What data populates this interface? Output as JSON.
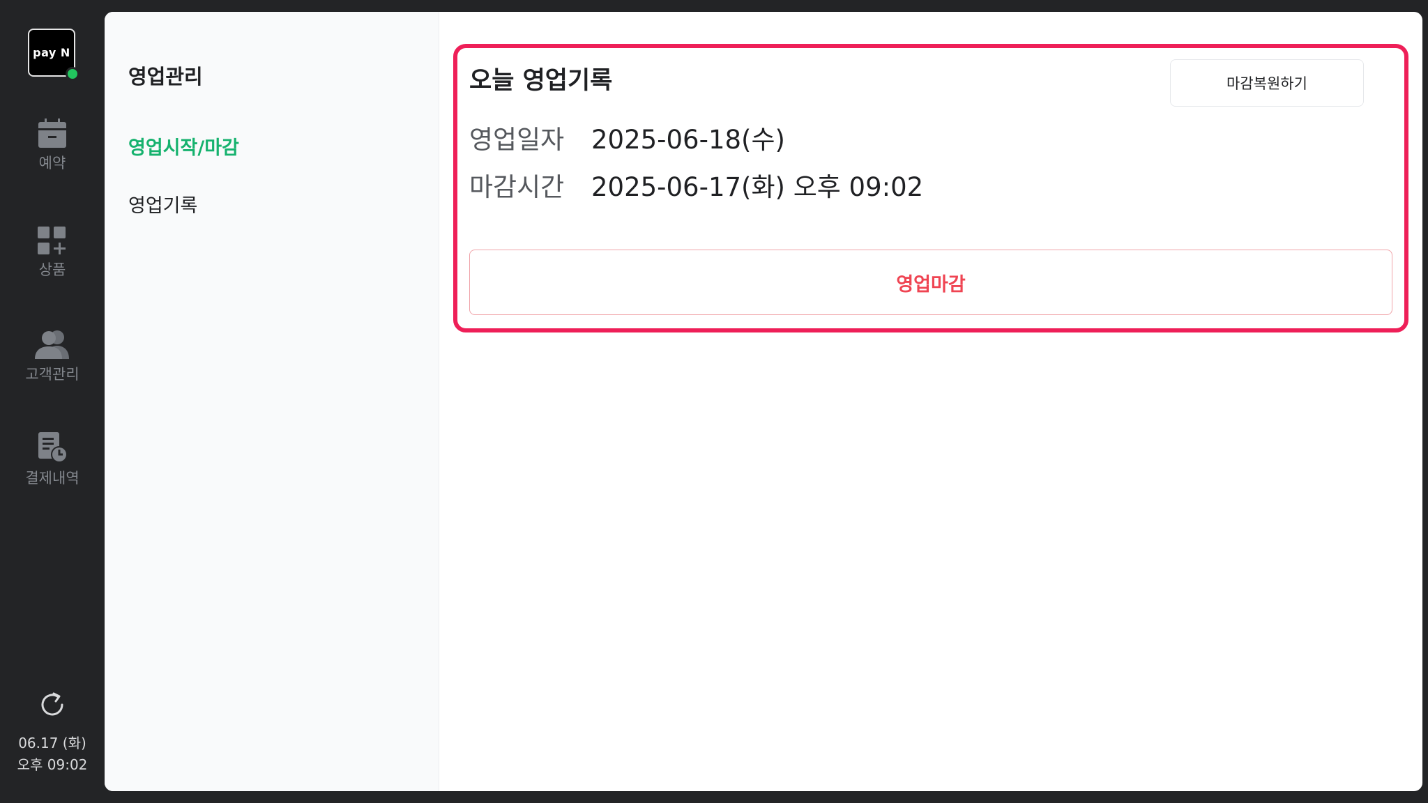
{
  "logo": {
    "text": "pay N"
  },
  "rail": {
    "items": [
      {
        "label": "예약",
        "icon": "calendar-icon"
      },
      {
        "label": "상품",
        "icon": "grid-plus-icon"
      },
      {
        "label": "고객관리",
        "icon": "users-icon"
      },
      {
        "label": "결제내역",
        "icon": "receipt-clock-icon"
      }
    ],
    "refresh_icon": "refresh-icon",
    "date": "06.17 (화)",
    "time": "오후 09:02"
  },
  "submenu": {
    "title": "영업관리",
    "items": [
      {
        "label": "영업시작/마감",
        "active": true
      },
      {
        "label": "영업기록",
        "active": false
      }
    ]
  },
  "card": {
    "title": "오늘 영업기록",
    "restore_button": "마감복원하기",
    "rows": [
      {
        "label": "영업일자",
        "value": "2025-06-18(수)"
      },
      {
        "label": "마감시간",
        "value": "2025-06-17(화) 오후 09:02"
      }
    ],
    "close_button": "영업마감"
  },
  "colors": {
    "accent_green": "#16b26e",
    "highlight_border": "#ee1f58",
    "close_text": "#ef4452",
    "status_dot": "#22c55e"
  }
}
